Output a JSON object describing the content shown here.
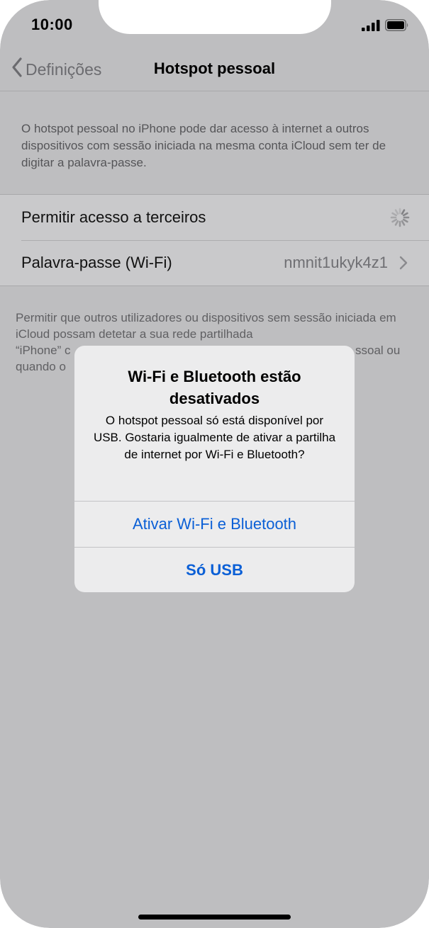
{
  "status_bar": {
    "time": "10:00",
    "icons": [
      "cellular-signal-icon",
      "battery-icon"
    ]
  },
  "nav": {
    "back_label": "Definições",
    "title": "Hotspot pessoal"
  },
  "description": "O hotspot pessoal no iPhone pode dar acesso à internet a outros dispositivos com sessão iniciada na mesma conta iCloud sem ter de digitar a palavra-passe.",
  "settings": {
    "rows": [
      {
        "label": "Permitir acesso a terceiros",
        "state": "loading"
      },
      {
        "label": "Palavra-passe (Wi-Fi)",
        "value": "nmnit1ukyk4z1"
      }
    ]
  },
  "footer_note": {
    "line1": "Permitir que outros utilizadores ou dispositivos sem sessão iniciada em iCloud possam detetar a sua rede partilhada",
    "line3_start": "“iPhone” c",
    "line3_end": "ssoal ou",
    "line4_start": "quando o"
  },
  "alert": {
    "title": "Wi-Fi e Bluetooth estão desativados",
    "message": "O hotspot pessoal só está disponível por USB. Gostaria igualmente de ativar a partilha de internet por Wi-Fi e Bluetooth?",
    "primary_button": "Ativar Wi-Fi e Bluetooth",
    "secondary_button": "Só USB"
  },
  "colors": {
    "background": "#bebec0",
    "alert_background": "#ececed",
    "accent": "#0a5fd6"
  }
}
